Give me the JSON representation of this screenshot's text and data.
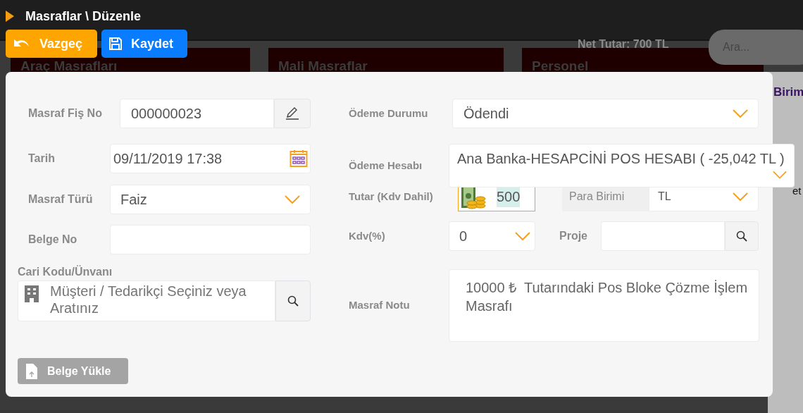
{
  "header": {
    "title": "Masraflar \\ Düzenle",
    "buttons": [
      {
        "label": "Vazgeç",
        "kind": "cancel"
      },
      {
        "label": "Kaydet",
        "kind": "save"
      }
    ],
    "net_total": "Net Tutar: 700 TL",
    "search": {
      "placeholder": "Ara..."
    }
  },
  "background": {
    "cards": [
      {
        "title": "Araç Masrafları"
      },
      {
        "title": "Mali Masraflar"
      },
      {
        "title": "Personel"
      }
    ],
    "side_texts": [
      "Birim",
      "et"
    ]
  },
  "form": {
    "left": [
      {
        "label": "Masraf Fiş No",
        "kind": "edit",
        "value": "000000023"
      },
      {
        "label": "Tarih",
        "kind": "date",
        "value": "09/11/2019 17:38"
      },
      {
        "label": "Masraf Türü",
        "kind": "select",
        "value": "Faiz"
      },
      {
        "label": "Belge No",
        "kind": "text"
      },
      {
        "label": "Cari Kodu/Ünvanı",
        "kind": "party",
        "placeholder": "Müşteri / Tedarikçi Seçiniz veya Aratınız"
      }
    ],
    "right": [
      {
        "label": "Ödeme Durumu",
        "kind": "select",
        "value": "Ödendi"
      },
      {
        "label": "Ödeme Hesabı",
        "kind": "account",
        "value": "Ana Banka-HESAPCİNİ POS HESABI ( -25,042 TL )"
      },
      {
        "label": "Tutar (Kdv Dahil)",
        "kind": "amount",
        "value": "500",
        "side": {
          "label": "Para Birimi",
          "value": "TL"
        }
      },
      {
        "label": "Kdv(%)",
        "kind": "vat",
        "value": "0",
        "side": {
          "label": "Proje"
        }
      },
      {
        "label": "Masraf Notu",
        "kind": "note",
        "value": "10000 ₺  Tutarındaki Pos Bloke Çözme İşlem Masrafı"
      }
    ],
    "upload_button": "Belge Yükle"
  }
}
